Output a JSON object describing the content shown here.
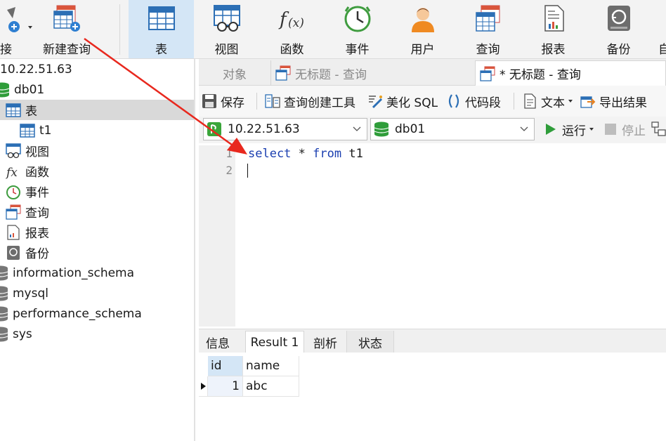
{
  "toolbar": {
    "items": [
      {
        "label": "接",
        "icon": "connection-icon"
      },
      {
        "label": "新建查询",
        "icon": "new-query-icon"
      },
      {
        "label": "表",
        "icon": "table-icon"
      },
      {
        "label": "视图",
        "icon": "view-icon"
      },
      {
        "label": "函数",
        "icon": "function-icon"
      },
      {
        "label": "事件",
        "icon": "event-clock-icon"
      },
      {
        "label": "用户",
        "icon": "user-icon"
      },
      {
        "label": "查询",
        "icon": "query-icon"
      },
      {
        "label": "报表",
        "icon": "report-icon"
      },
      {
        "label": "备份",
        "icon": "backup-icon"
      },
      {
        "label": "自",
        "icon": "automation-icon"
      }
    ]
  },
  "sidebar": {
    "connection": "10.22.51.63",
    "database": "db01",
    "items": [
      {
        "label": "表"
      },
      {
        "label": "t1"
      },
      {
        "label": "视图"
      },
      {
        "label": "函数"
      },
      {
        "label": "事件"
      },
      {
        "label": "查询"
      },
      {
        "label": "报表"
      },
      {
        "label": "备份"
      }
    ],
    "other_dbs": [
      "information_schema",
      "mysql",
      "performance_schema",
      "sys"
    ]
  },
  "tabs": {
    "objects": "对象",
    "query1": "无标题 - 查询",
    "query2": "* 无标题 - 查询"
  },
  "editor_toolbar": {
    "save": "保存",
    "builder": "查询创建工具",
    "beautify": "美化 SQL",
    "snippet": "代码段",
    "text": "文本",
    "export": "导出结果"
  },
  "selectors": {
    "connection": "10.22.51.63",
    "database": "db01",
    "run": "运行",
    "stop": "停止"
  },
  "editor": {
    "line_numbers": [
      "1",
      "2"
    ],
    "kw_select": "select",
    "star": "*",
    "kw_from": "from",
    "table": "t1"
  },
  "results": {
    "tabs": [
      "信息",
      "Result 1",
      "剖析",
      "状态"
    ],
    "columns": [
      "id",
      "name"
    ],
    "rows": [
      [
        "1",
        "abc"
      ]
    ]
  },
  "colors": {
    "accent": "#d4e6f6",
    "keyword": "#1a3eb0",
    "arrow": "#e8281e",
    "db_green": "#2f9d3a"
  }
}
